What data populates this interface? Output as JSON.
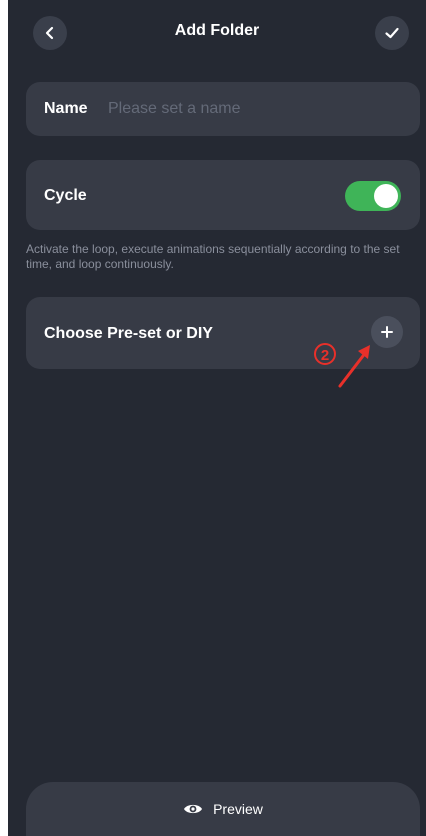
{
  "header": {
    "title": "Add Folder",
    "back_icon": "chevron-left-icon",
    "confirm_icon": "check-icon"
  },
  "name_field": {
    "label": "Name",
    "placeholder": "Please set a name",
    "value": ""
  },
  "cycle": {
    "label": "Cycle",
    "enabled": true,
    "description": "Activate the loop, execute animations sequentially according to the set time, and loop continuously."
  },
  "choose": {
    "label": "Choose Pre-set or DIY",
    "add_icon": "plus-icon"
  },
  "annotation": {
    "marker": "②",
    "color": "#e8302a"
  },
  "footer": {
    "preview_label": "Preview",
    "preview_icon": "eye-icon"
  },
  "colors": {
    "background": "#252933",
    "card": "#373b46",
    "toggle_on": "#3fb458"
  }
}
